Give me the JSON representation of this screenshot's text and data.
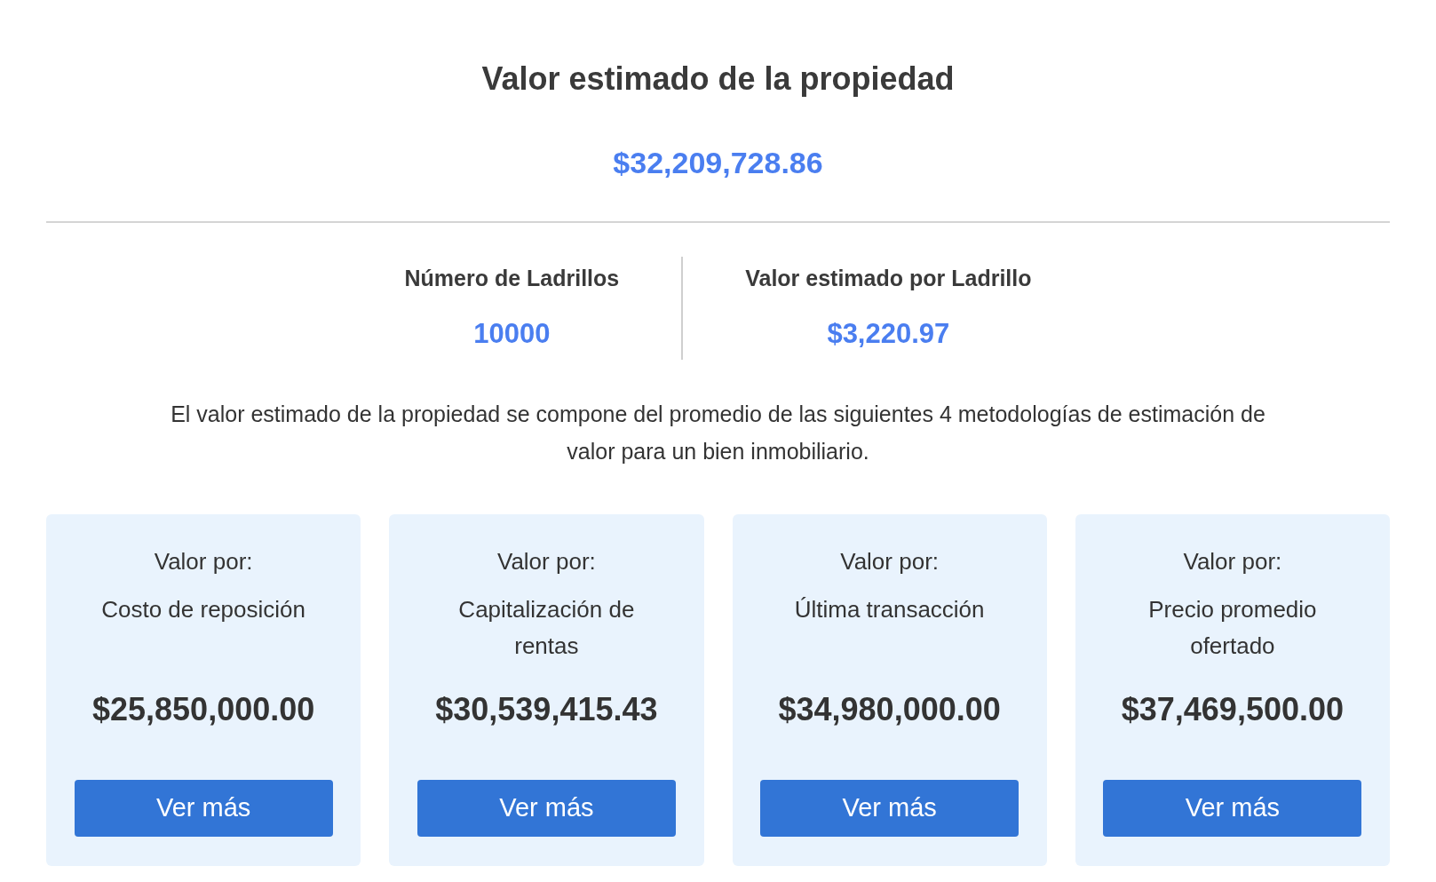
{
  "title": "Valor estimado de la propiedad",
  "total": "$32,209,728.86",
  "stats": [
    {
      "label": "Número de Ladrillos",
      "value": "10000"
    },
    {
      "label": "Valor estimado por Ladrillo",
      "value": "$3,220.97"
    }
  ],
  "description": "El valor estimado de la propiedad se compone del promedio de las siguientes 4 metodologías de estimación de valor para un bien inmobiliario.",
  "methods": [
    {
      "label": "Valor por:",
      "name": "Costo de reposición",
      "amount": "$25,850,000.00",
      "button": "Ver más"
    },
    {
      "label": "Valor por:",
      "name": "Capitalización de rentas",
      "amount": "$30,539,415.43",
      "button": "Ver más"
    },
    {
      "label": "Valor por:",
      "name": "Última transacción",
      "amount": "$34,980,000.00",
      "button": "Ver más"
    },
    {
      "label": "Valor por:",
      "name": "Precio promedio ofertado",
      "amount": "$37,469,500.00",
      "button": "Ver más"
    }
  ]
}
